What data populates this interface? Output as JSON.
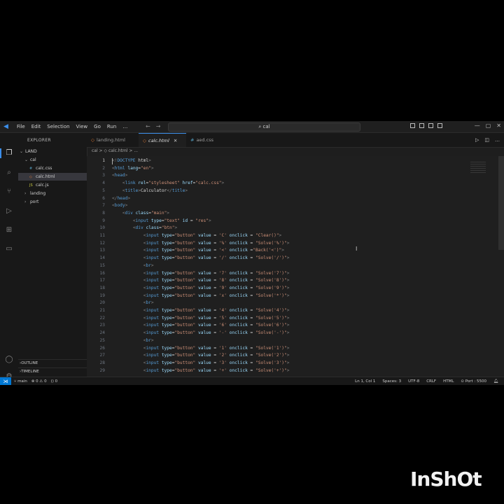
{
  "titlebar": {
    "menu": [
      "File",
      "Edit",
      "Selection",
      "View",
      "Go",
      "Run",
      "…"
    ],
    "search": "⌕ cal"
  },
  "sidebar": {
    "title": "EXPLORER",
    "root": "LAND",
    "items": [
      {
        "label": "cal",
        "kind": "folder",
        "indent": 1
      },
      {
        "label": "calc.css",
        "kind": "css",
        "indent": 2
      },
      {
        "label": "calc.html",
        "kind": "html",
        "indent": 2,
        "selected": true
      },
      {
        "label": "calc.js",
        "kind": "js",
        "indent": 2
      },
      {
        "label": "landing",
        "kind": "folder-closed",
        "indent": 1
      },
      {
        "label": "port",
        "kind": "folder-closed",
        "indent": 1
      }
    ],
    "outline": "OUTLINE",
    "timeline": "TIMELINE"
  },
  "tabs": [
    {
      "label": "landing.html",
      "active": false
    },
    {
      "label": "calc.html",
      "active": true
    },
    {
      "label": "aed.css",
      "active": false
    }
  ],
  "breadcrumb": "cal > ◇ calc.html > ...",
  "code_lines": [
    "<!DOCTYPE html>",
    "<html lang=\"en\">",
    "<head>",
    "    <link rel=\"stylesheet\" href=\"calc.css\">",
    "    <title>Calculator</title>",
    "</head>",
    "<body>",
    "    <div class=\"main\">",
    "        <input type=\"text\" id = \"res\">",
    "        <div class=\"btn\">",
    "            <input type=\"button\" value = 'C' onclick = \"Clear()\">",
    "            <input type=\"button\" value = '%' onclick = \"Solve('%')\">",
    "            <input type=\"button\" value = '<' onclick =\"Back('<')\">",
    "            <input type=\"button\" value = '/' onclick = \"Solve('/')\">",
    "            <br>",
    "            <input type=\"button\" value = '7' onclick = \"Solve('7')\">",
    "            <input type=\"button\" value = '8' onclick = \"Solve('8')\">",
    "            <input type=\"button\" value = '9' onclick = \"Solve('9')\">",
    "            <input type=\"button\" value = 'x' onclick = \"Solve('*')\">",
    "            <br>",
    "            <input type=\"button\" value = '4' onclick = \"Solve('4')\">",
    "            <input type=\"button\" value = '5' onclick = \"Solve('5')\">",
    "            <input type=\"button\" value = '6' onclick = \"Solve('6')\">",
    "            <input type=\"button\" value = '-' onclick = \"Solve('-')\">",
    "            <br>",
    "            <input type=\"button\" value = '1' onclick = \"Solve('1')\">",
    "            <input type=\"button\" value = '2' onclick = \"Solve('2')\">",
    "            <input type=\"button\" value = '3' onclick = \"Solve('3')\">",
    "            <input type=\"button\" value = '+' onclick = \"Solve('+')\">"
  ],
  "current_line": 1,
  "statusbar": {
    "branch": "main",
    "problems": "⊗ 0 ⚠ 0",
    "ports": "() 0",
    "right": [
      "Ln 1, Col 1",
      "Spaces: 3",
      "UTF-8",
      "CRLF",
      "HTML",
      "⊙ Port : 5500"
    ]
  },
  "watermark": "InShOt",
  "colors": {
    "accent": "#3b8eea",
    "tag": "#569cd6",
    "attr": "#9cdcfe",
    "string": "#ce9178"
  }
}
